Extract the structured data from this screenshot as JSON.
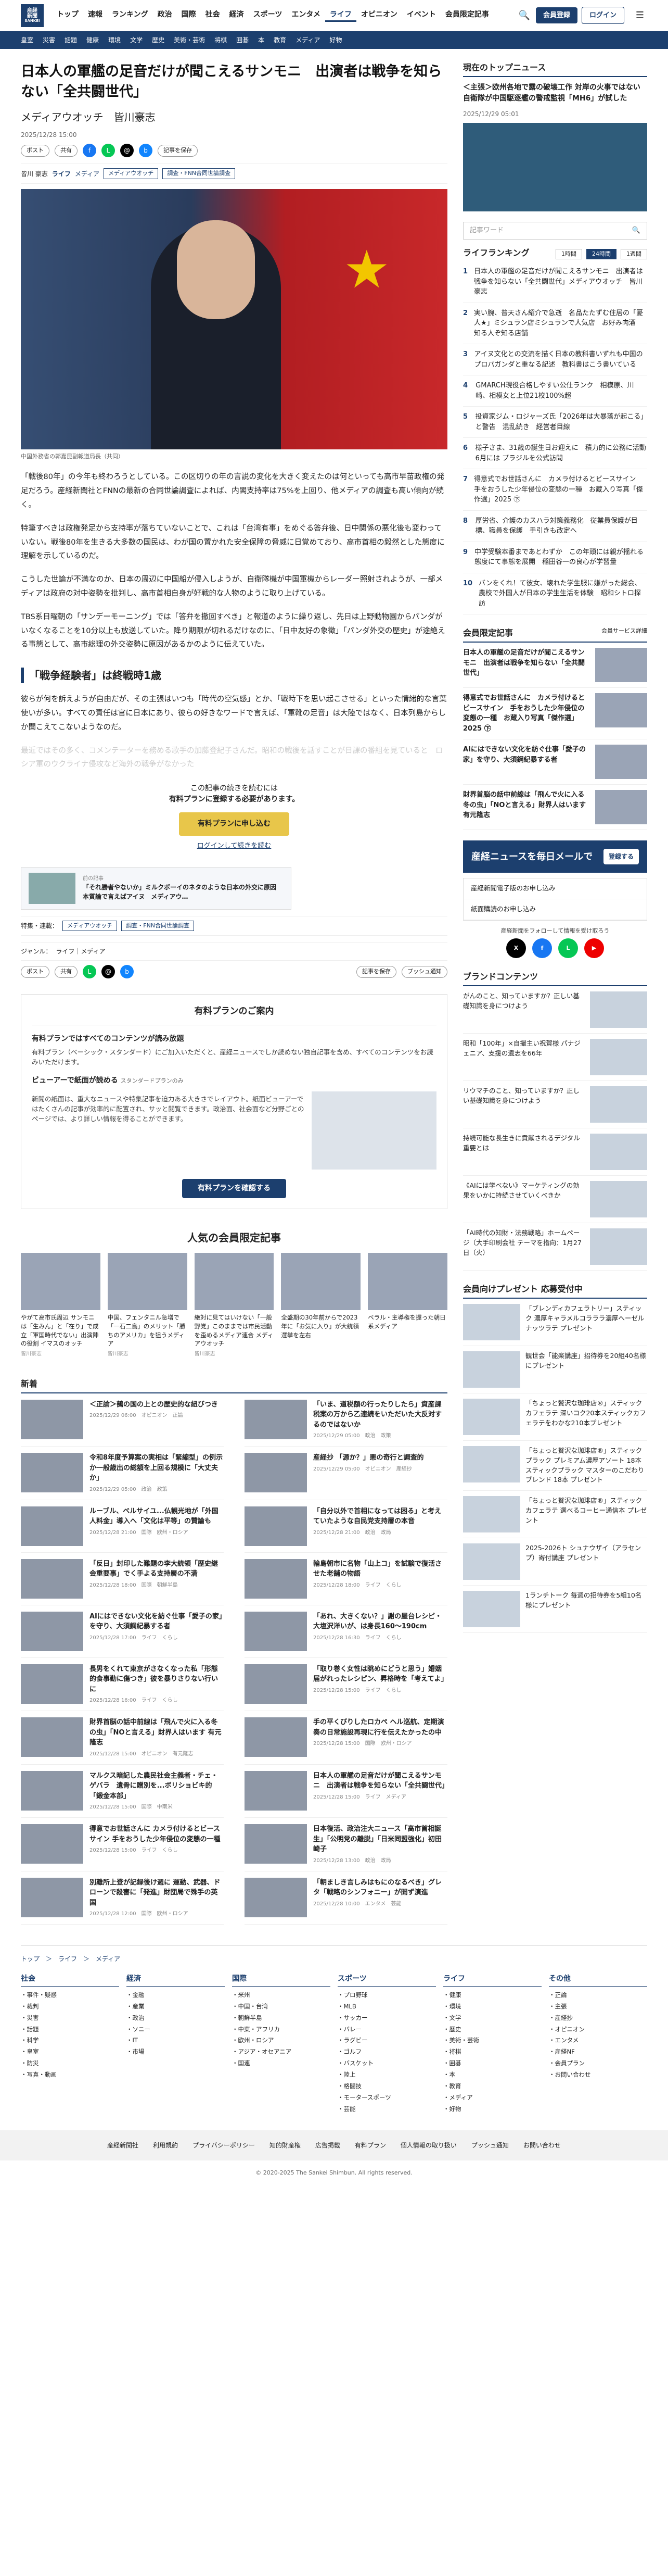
{
  "header": {
    "logo_lines": [
      "産経",
      "新聞",
      "SANKEI"
    ],
    "nav": [
      "トップ",
      "速報",
      "ランキング",
      "政治",
      "国際",
      "社会",
      "経済",
      "スポーツ",
      "エンタメ",
      "ライフ",
      "オピニオン",
      "イベント",
      "会員限定記事"
    ],
    "active_nav": "ライフ",
    "register": "会員登録",
    "login": "ログイン",
    "menu": "メニュー",
    "search_icon": "🔍",
    "menu_icon": "☰"
  },
  "subnav": [
    "皇室",
    "災害",
    "話題",
    "健康",
    "環境",
    "文学",
    "歴史",
    "美術・芸術",
    "将棋",
    "囲碁",
    "本",
    "教育",
    "メディア",
    "好物"
  ],
  "article": {
    "title": "日本人の軍艦の足音だけが聞こえるサンモニ　出演者は戦争を知らない「全共闘世代」",
    "series": "メディアウオッチ　皆川豪志",
    "date": "2025/12/28 15:00",
    "share_x": "ポスト",
    "share_fb": "共有",
    "save": "記事を保存",
    "author": "皆川 豪志",
    "category": "ライフ",
    "subcategory": "メディア",
    "tags": [
      "メディアウオッチ",
      "調査・FNN合同世論調査"
    ],
    "caption": "中国外務省の郭嘉昆副報道局長（共同）",
    "paragraphs": [
      "「戦後80年」の今年も終わろうとしている。この区切りの年の言説の変化を大きく変えたのは何といっても高市早苗政権の発足だろう。産経新聞社とFNNの最新の合同世論調査によれば、内閣支持率は75%を上回り、他メディアの調査も高い傾向が続く。",
      "特筆すべきは政権発足から支持率が落ちていないことで、これは「台湾有事」をめぐる答弁後、日中関係の悪化後も変わっていない。戦後80年を生きる大多数の国民は、わが国の置かれた安全保障の脅威に日覚めており、高市首相の毅然とした態度に理解を示しているのだ。",
      "こうした世論が不満なのか、日本の周辺に中国船が侵入しようが、自衛隊機が中国軍機からレーダー照射されようが、一部メディアは政府の対中姿勢を批判し、高市首相自身が好戦的な人物のように取り上げている。",
      "TBS系日曜朝の「サンデーモーニング」では「答弁を撤回すべき」と報道のように繰り返し、先日は上野動物園からパンダがいなくなることを10分以上も放送していた。降り期限が切れるだけなのに、「日中友好の象徴」「パンダ外交の歴史」が途絶える事態として、高市総理の外交姿勢に原因があるかのように伝えていた。"
    ],
    "h2": "「戦争経験者」は終戦時1歳",
    "p5": "彼らが何を訴えようが自由だが、その主張はいつも「時代の空気感」とか、「戦時下を思い起こさせる」といった情緒的な言葉使いが多い。すべての責任は官に日本にあり、彼らの好きなワードで言えば、「軍靴の足音」は大陸ではなく、日本列島からしか聞こえてこないようなのだ。",
    "p6_fade": "最近ではその多く、コメンテーターを務める歌手の加藤登紀子さんだ。昭和の戦後を話すことが日課の番組を見ていると　ロシア軍のウクライナ侵攻など海外の戦争がなかった",
    "paywall_1": "この記事の続きを読むには",
    "paywall_2": "有料プランに登録する必要があります。",
    "paywall_cta": "有料プランに申し込む",
    "paywall_login": "ログインして続きを読む",
    "related_label": "前の記事",
    "related_title": "「それ勝者やないか」ミルクボーイのネタのような日本の外交に原因　本質論で言えばアイヌ　メディアウ…",
    "related_tags_label": "特集・連載：",
    "genre_label": "ジャンル：",
    "genre": "ライフ｜メディア",
    "push": "プッシュ通知"
  },
  "plan": {
    "title": "有料プランのご案内",
    "h1": "有料プランではすべてのコンテンツが読み放題",
    "p1": "有料プラン（ベーシック・スタンダード）にご加入いただくと、産経ニュースでしか読めない独自記事を含め、すべてのコンテンツをお読みいただけます。",
    "h2": "ビューアーで紙面が読める",
    "h2_sub": "スタンダードプランのみ",
    "p2": "新聞の紙面は、重大なニュースや特集記事を迫力ある大きさでレイアウト。紙面ビューアーではたくさんの記事が効率的に配置され、サッと閲覧できます。政治面、社会面など分野ごとのページでは、より詳しい情報を得ることができます。",
    "cta": "有料プランを確認する"
  },
  "popular": {
    "title": "人気の会員限定記事",
    "items": [
      {
        "title": "やがて高市氏周辺 サンモニは「生みん」と「在り」で成立「軍国時代でない」出演陣の役割 イマスのオッチ",
        "author": "皆川豪志"
      },
      {
        "title": "中国、フェンタニル急増で「一石二鳥」のメリット「勝ちのアメリカ」を狙うメディア",
        "author": "皆川豪志"
      },
      {
        "title": "絶対に見てはいけない「一般野党」このままでは市民活動を歪めるメディア連合 メディアウオッチ",
        "author": "皆川豪志"
      },
      {
        "title": "全盛期の30年前からで2023年に「お気に入り」が大統領選挙を左右",
        "author": ""
      },
      {
        "title": "ベラル・主導権を握った朝日系メディア",
        "author": ""
      }
    ]
  },
  "news": {
    "title": "新着",
    "items": [
      {
        "title": "＜正論＞鵺の国の上との歴史的な紐びつき",
        "date": "2025/12/29 06:00",
        "cat": "オピニオン",
        "sub": "正論"
      },
      {
        "title": "「いま、道税額の行ったりしたら」資産課税案の万から乙連続をいただいた大反対するのではないか",
        "date": "2025/12/29 05:00",
        "cat": "政治",
        "sub": "政策"
      },
      {
        "title": "令和8年度予算案の実相は「緊縮型」の例示か一般歳出の総額を上回る規模に「大丈夫か」",
        "date": "2025/12/29 05:00",
        "cat": "政治",
        "sub": "政策"
      },
      {
        "title": "産経抄 「源か？」悪の奇行と調査的",
        "date": "2025/12/29 05:00",
        "cat": "オピニオン",
        "sub": "産経抄"
      },
      {
        "title": "ルーブル、ベルサイユ...仏観光地が「外国人料金」導入へ「文化は平等」の賛論も",
        "date": "2025/12/28 21:00",
        "cat": "国際",
        "sub": "欧州・ロシア"
      },
      {
        "title": "「自分以外で首相になっては困る」と考えていたような自民党支持層の本音",
        "date": "2025/12/28 21:00",
        "cat": "政治",
        "sub": "政局"
      },
      {
        "title": "「反日」封印した難題の李大統領「歴史継会重要事」でく手よる支持層の不満",
        "date": "2025/12/28 18:00",
        "cat": "国際",
        "sub": "朝鮮半島"
      },
      {
        "title": "輪島朝市に名物「山上コ」を試験で復活させた老舗の物語",
        "date": "2025/12/28 18:00",
        "cat": "ライフ",
        "sub": "くらし"
      },
      {
        "title": "AIにはできない文化を紡ぐ仕事「愛子の家」を守り、大須鋼紀暴する者",
        "date": "2025/12/28 17:00",
        "cat": "ライフ",
        "sub": "くらし"
      },
      {
        "title": "「あれ、大きくない？」謝の屋台レシピ・大塩沢洋いが、は身長160～190cm",
        "date": "2025/12/28 16:30",
        "cat": "ライフ",
        "sub": "くらし"
      },
      {
        "title": "長男をくれて東京がさなくなった私「形態的食事勤に傷つき」彼を暴りさりない行いに",
        "date": "2025/12/28 16:00",
        "cat": "ライフ",
        "sub": "くらし"
      },
      {
        "title": "「取り巻く女性は眺めにどうと思う」婚姻届がれったレシピン、昇格時を「考えてよ」",
        "date": "2025/12/28 15:00",
        "cat": "ライフ",
        "sub": "くらし"
      },
      {
        "title": "財界首脳の話中前線は「飛んで火に入る冬の虫」「NOと言える」財界人はいます 有元隆志",
        "date": "2025/12/28 15:00",
        "cat": "オピニオン",
        "sub": "有元隆志"
      },
      {
        "title": "手の平くびりしたロカペ ヘル巡航、定期演奏の日常施設再現に行を伝えたかったの中",
        "date": "2025/12/28 15:00",
        "cat": "国際",
        "sub": "欧州・ロシア"
      },
      {
        "title": "マルクス暗記した農民社会主義者・チェ・ゲバラ　遺骨に贈別を...ボリショビキ的「鍛金本部」",
        "date": "2025/12/28 15:00",
        "cat": "国際",
        "sub": "中南米"
      },
      {
        "title": "日本人の軍艦の足音だけが聞こえるサンモニ　出演者は戦争を知らない「全共闘世代」",
        "date": "2025/12/28 15:00",
        "cat": "ライフ",
        "sub": "メディア"
      },
      {
        "title": "得意でお世話さんに カメラ付けるとビースサイン 手をおうした少年侵位の変態の一種",
        "date": "2025/12/28 15:00",
        "cat": "ライフ",
        "sub": "くらし"
      },
      {
        "title": "日本復活、政治注大ニュース「高市首相誕生」「公明党の離脱」「日米同盟強化」初田崎子",
        "date": "2025/12/28 13:00",
        "cat": "政治",
        "sub": "政局"
      },
      {
        "title": "別離所上登が記録後け週に 運動、武器、ドローンで殺害に「発進」財団局で殊手の英国",
        "date": "2025/12/28 12:00",
        "cat": "国際",
        "sub": "欧州・ロシア"
      },
      {
        "title": "「朝ましき言しみはもにのなるべき」グレタ「戦略のシンフォニー」が開ず演進",
        "date": "2025/12/28 10:00",
        "cat": "エンタメ",
        "sub": "芸能"
      }
    ]
  },
  "side": {
    "topnews_title": "現在のトップニュース",
    "topnews_headline": "＜主張＞欧州各地で露の破壊工作 対岸の火事ではない　自衛隊が中国駆逐艦の警戒監視「MH6」が試した",
    "topnews_date": "2025/12/29 05:01",
    "search_placeholder": "記事ワード",
    "rank_title": "ライフランキング",
    "rank_tabs": [
      "1時間",
      "24時間",
      "1週間"
    ],
    "rank_items": [
      "日本人の軍艦の足音だけが聞こえるサンモニ　出演者は戦争を知らない「全共闘世代」メディアウオッチ　皆川豪志",
      "実い腕、普天さん紹介で急逝　名品たたずむ住居の「憂人★」ミシュラン店ミシュランで人気店　お好み肉酒　知る人ぞ知る店舗",
      "アイヌ文化との交流を描く日本の教科書いずれも中国のプロパガンダと重なる記述　教科書はこう書いている",
      "GMARCH現役合格しやすい公仕ランク　相模原、川崎、相模女と上位21校100%超",
      "投資家ジム・ロジャーズ氏「2026年は大暴落が起こる」と警告　混乱続き　経営者目線",
      "様子さま、31歳の誕生日お迎えに　積力的に公務に活動　6月には ブラジルを公式訪問",
      "得意式でお世話さんに　カメラ付けるとビースサイン　手をおうした少年侵位の変態の一種　お蔵入り写真「傑作選」2025 ㊦",
      "厚労省、介護のカスハラ対策義務化　従業員保護が目標、職員を保護　手引きも改定へ",
      "中学受験本番まであとわずか　この年頭には親が揺れる態度にて事態を展開　稲田谷一の良心が学習量",
      "バンをくれ！て彼女、壊れた学生服に嫌がった総会、農校で外国人が日本の学生生活を体験　昭和シトロ探訪"
    ],
    "mem_title": "会員限定記事",
    "mem_link": "会員サービス詳細",
    "mem_items": [
      "日本人の軍艦の足音だけが聞こえるサンモニ　出演者は戦争を知らない「全共闘世代」",
      "得意式でお世話さんに　カメラ付けるとビースサイン　手をおうした少年侵位の変態の一種　お蔵入り写真「傑作選」2025 ㊦",
      "AIにはできない文化を紡ぐ仕事「愛子の家」を守り、大須鋼紀暴する者",
      "財界首脳の話中前線は「飛んで火に入る冬の虫」「NOと言える」財界人はいます 有元隆志"
    ],
    "promo": "産経ニュースを毎日メールで",
    "promo_btn": "登録する",
    "links": [
      "産経新聞電子版のお申し込み",
      "紙面購読のお申し込み"
    ],
    "sns_text": "産経新聞をフォローして情報を受け取ろう",
    "sns": [
      "X",
      "f",
      "L",
      "▶"
    ],
    "brand_title": "ブランドコンテンツ",
    "brand_items": [
      "がんのこと、知っていますか？正しい基礎知識を身につけよう",
      "昭和「100年」×自撮主い祝賀様 パナジェニア、支援の遺志を66年",
      "リウマチのこと、知っていますか？正しい基礎知識を身につけよう",
      "持続可能な長生きに貢献されるデジタル重要とは",
      "《AIには学べない》マーケティングの効果をいかに持続させていくべきか",
      "「AI時代の知財・法務戦略」ホームページ（大手印刷会社 テーマを指向：1月27日（火）"
    ],
    "pres_title": "会員向けプレゼント 応募受付中",
    "pres_items": [
      "「ブレンディカフェラトリー」スティック 濃厚キャラメルコラララ濃厚ヘーゼルナッツラテ プレゼント",
      "観世会「能楽講座」招待券を20組40名様にプレゼント",
      "「ちょっと贅沢な珈琲店®」スティックカフェラテ 深いコク20本スティックカフェラテをわかな210本プレゼント",
      "「ちょっと贅沢な珈琲店®」スティックプラック プレミアム濃厚アソート 18本スティックプラック マスターのこだわりブレンド 18本 プレゼント",
      "「ちょっと贅沢な珈琲店®」スティックカフェラテ 選べるコーヒー通信本 プレゼント",
      "2025-2026ト シュナウザイ（アラセンプ）寄付講座 プレゼント",
      "1ランチトーク 毎週の招待券を5組10名様にプレゼント"
    ]
  },
  "footer": {
    "crumb": "トップ　＞　ライフ　＞　メディア",
    "cols": [
      {
        "h": "社会",
        "items": [
          "事件・疑惑",
          "裁判",
          "災害",
          "話題",
          "科学",
          "皇室",
          "防災",
          "写真・動画"
        ]
      },
      {
        "h": "経済",
        "items": [
          "金融",
          "産業",
          "政治",
          "ソニー",
          "IT",
          "市場"
        ]
      },
      {
        "h": "国際",
        "items": [
          "米州",
          "中国・台湾",
          "朝鮮半島",
          "中東・アフリカ",
          "欧州・ロシア",
          "アジア・オセアニア",
          "国連"
        ]
      },
      {
        "h": "スポーツ",
        "items": [
          "プロ野球",
          "MLB",
          "サッカー",
          "バレー",
          "ラグビー",
          "ゴルフ",
          "バスケット",
          "陸上",
          "格闘技",
          "モータースポーツ",
          "芸能"
        ]
      },
      {
        "h": "ライフ",
        "items": [
          "健康",
          "環境",
          "文学",
          "歴史",
          "美術・芸術",
          "将棋",
          "囲碁",
          "本",
          "教育",
          "メディア",
          "好物"
        ]
      },
      {
        "h": "その他",
        "items": [
          "正論",
          "主張",
          "産経抄",
          "オピニオン",
          "エンタメ",
          "産経NF",
          "会員プラン",
          "お問い合わせ"
        ]
      }
    ],
    "bar": [
      "産経新聞社",
      "利用規約",
      "プライバシーポリシー",
      "知的財産権",
      "広告掲載",
      "有料プラン",
      "個人情報の取り扱い",
      "プッシュ通知",
      "お問い合わせ"
    ],
    "copy": "© 2020-2025 The Sankei Shimbun. All rights reserved."
  }
}
